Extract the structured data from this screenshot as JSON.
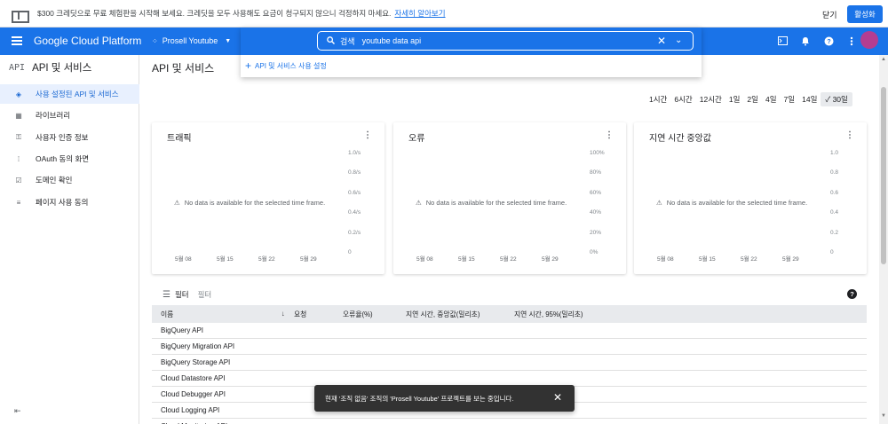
{
  "promo": {
    "text": "$300 크레딧으로 무료 체험판을 시작해 보세요. 크레딧을 모두 사용해도 요금이 청구되지 않으니 걱정하지 마세요.",
    "link": "자세히 알아보기",
    "close": "닫기",
    "activate": "활성화"
  },
  "header": {
    "brand": "Google Cloud Platform",
    "project": "Prosell Youtube"
  },
  "search": {
    "label": "검색",
    "value": "youtube data api",
    "suggestion": "API 및 서비스 사용 설정"
  },
  "sidebar": {
    "icon": "API",
    "title": "API 및 서비스",
    "items": [
      {
        "label": "사용 설정된 API 및 서비스",
        "icon": "diamond-icon"
      },
      {
        "label": "라이브러리",
        "icon": "library-icon"
      },
      {
        "label": "사용자 인증 정보",
        "icon": "key-icon"
      },
      {
        "label": "OAuth 동의 화면",
        "icon": "consent-icon"
      },
      {
        "label": "도메인 확인",
        "icon": "checkbox-icon"
      },
      {
        "label": "페이지 사용 동의",
        "icon": "settings-list-icon"
      }
    ]
  },
  "main": {
    "title": "API 및 서비스",
    "time_ranges": [
      "1시간",
      "6시간",
      "12시간",
      "1일",
      "2일",
      "4일",
      "7일",
      "14일",
      "30일"
    ],
    "time_selected": "30일"
  },
  "cards": [
    {
      "title": "트래픽",
      "no_data": "No data is available for the selected time frame.",
      "y_labels": [
        "1.0/s",
        "0.8/s",
        "0.6/s",
        "0.4/s",
        "0.2/s",
        "0"
      ],
      "x_labels": [
        "5월 08",
        "5월 15",
        "5월 22",
        "5월 29"
      ]
    },
    {
      "title": "오류",
      "no_data": "No data is available for the selected time frame.",
      "y_labels": [
        "100%",
        "80%",
        "60%",
        "40%",
        "20%",
        "0%"
      ],
      "x_labels": [
        "5월 08",
        "5월 15",
        "5월 22",
        "5월 29"
      ]
    },
    {
      "title": "지연 시간 중앙값",
      "no_data": "No data is available for the selected time frame.",
      "y_labels": [
        "1.0",
        "0.8",
        "0.6",
        "0.4",
        "0.2",
        "0"
      ],
      "x_labels": [
        "5월 08",
        "5월 15",
        "5월 22",
        "5월 29"
      ]
    }
  ],
  "table": {
    "filter_label": "필터",
    "filter_placeholder": "필터",
    "columns": [
      "이름",
      "요청",
      "오류율(%)",
      "지연 시간, 중앙값(밀리초)",
      "지연 시간, 95%(밀리초)"
    ],
    "rows": [
      "BigQuery API",
      "BigQuery Migration API",
      "BigQuery Storage API",
      "Cloud Datastore API",
      "Cloud Debugger API",
      "Cloud Logging API",
      "Cloud Monitoring API"
    ]
  },
  "toast": {
    "message": "현재 '조직 없음' 조직의 'Prosell Youtube' 프로젝트를 보는 중입니다."
  }
}
